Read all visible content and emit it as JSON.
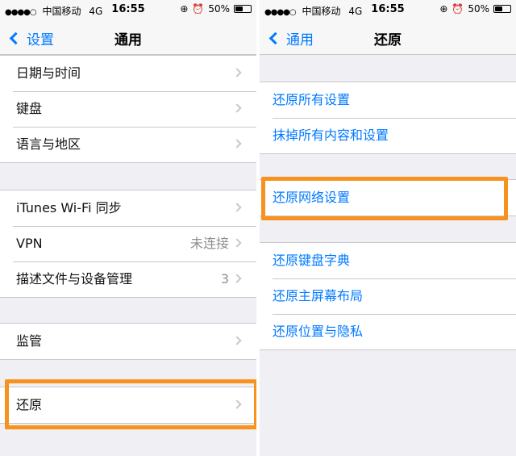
{
  "status_bar": {
    "signal_dots": "●●●●○",
    "carrier": "中国移动",
    "network": "4G",
    "time": "16:55",
    "lock_icon": "orientation-lock-icon",
    "alarm_icon": "alarm-icon",
    "battery_text": "50%",
    "battery_level": 0.5
  },
  "left": {
    "back_label": "设置",
    "title": "通用",
    "group1": [
      {
        "label": "日期与时间"
      },
      {
        "label": "键盘"
      },
      {
        "label": "语言与地区"
      }
    ],
    "group2": [
      {
        "label": "iTunes Wi-Fi 同步"
      },
      {
        "label": "VPN",
        "detail": "未连接"
      },
      {
        "label": "描述文件与设备管理",
        "detail": "3"
      }
    ],
    "group3": [
      {
        "label": "监管"
      }
    ],
    "group4": [
      {
        "label": "还原"
      }
    ]
  },
  "right": {
    "back_label": "通用",
    "title": "还原",
    "group1": [
      {
        "label": "还原所有设置"
      },
      {
        "label": "抹掉所有内容和设置"
      }
    ],
    "group2": [
      {
        "label": "还原网络设置"
      }
    ],
    "group3": [
      {
        "label": "还原键盘字典"
      },
      {
        "label": "还原主屏幕布局"
      },
      {
        "label": "还原位置与隐私"
      }
    ]
  },
  "colors": {
    "accent": "#007aff",
    "highlight": "#f7921e",
    "background": "#efeff4"
  }
}
